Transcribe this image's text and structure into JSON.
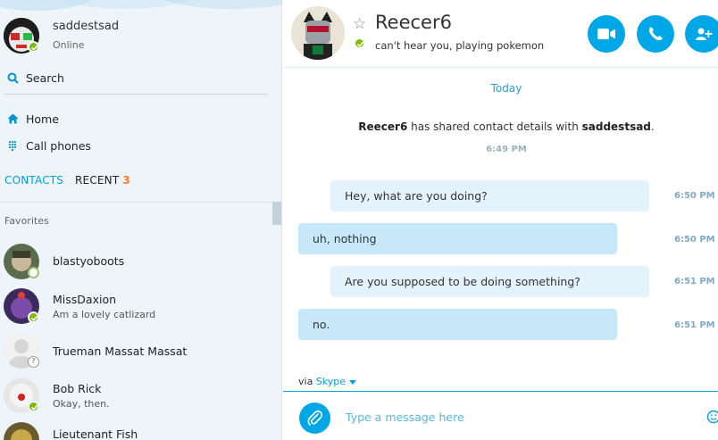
{
  "profile": {
    "name": "saddestsad",
    "status": "Online"
  },
  "nav": {
    "search_label": "Search",
    "home_label": "Home",
    "call_phones_label": "Call phones"
  },
  "tabs": {
    "contacts_label": "CONTACTS",
    "recent_label": "RECENT",
    "recent_count": "3"
  },
  "contacts": {
    "section_label": "Favorites",
    "items": [
      {
        "name": "blastyoboots",
        "mood": "",
        "presence": "offline"
      },
      {
        "name": "MissDaxion",
        "mood": "Am a lovely catlizard",
        "presence": "online"
      },
      {
        "name": "Trueman Massat Massat",
        "mood": "",
        "presence": "unknown"
      },
      {
        "name": "Bob Rick",
        "mood": "Okay, then.",
        "presence": "online"
      },
      {
        "name": "Lieutenant Fish",
        "mood": "",
        "presence": "online"
      }
    ]
  },
  "chat": {
    "peer_name": "Reecer6",
    "peer_mood": "can't hear you, playing pokemon",
    "day_label": "Today",
    "event": {
      "actor": "Reecer6",
      "action": " has shared contact details with ",
      "target": "saddestsad",
      "end": ".",
      "time": "6:49 PM"
    },
    "messages": [
      {
        "text": "Hey, what are you doing?",
        "time": "6:50 PM",
        "direction": "out"
      },
      {
        "text": "uh, nothing",
        "time": "6:50 PM",
        "direction": "in"
      },
      {
        "text": "Are you supposed to be doing something?",
        "time": "6:51 PM",
        "direction": "out"
      },
      {
        "text": "no.",
        "time": "6:51 PM",
        "direction": "in"
      }
    ],
    "via_prefix": "via",
    "via_service": "Skype"
  },
  "composer": {
    "placeholder": "Type a message here"
  },
  "icons": {
    "video_call": "video-camera-icon",
    "audio_call": "phone-icon",
    "add_people": "add-person-icon",
    "attach": "paperclip-icon",
    "emoji": "smiley-icon",
    "favorite": "star-outline-icon"
  },
  "colors": {
    "accent": "#00a7e6",
    "online": "#7fba00",
    "recent_badge": "#f47e20",
    "bubble_outgoing": "#e4f3fb",
    "bubble_incoming": "#c7e8f9"
  }
}
